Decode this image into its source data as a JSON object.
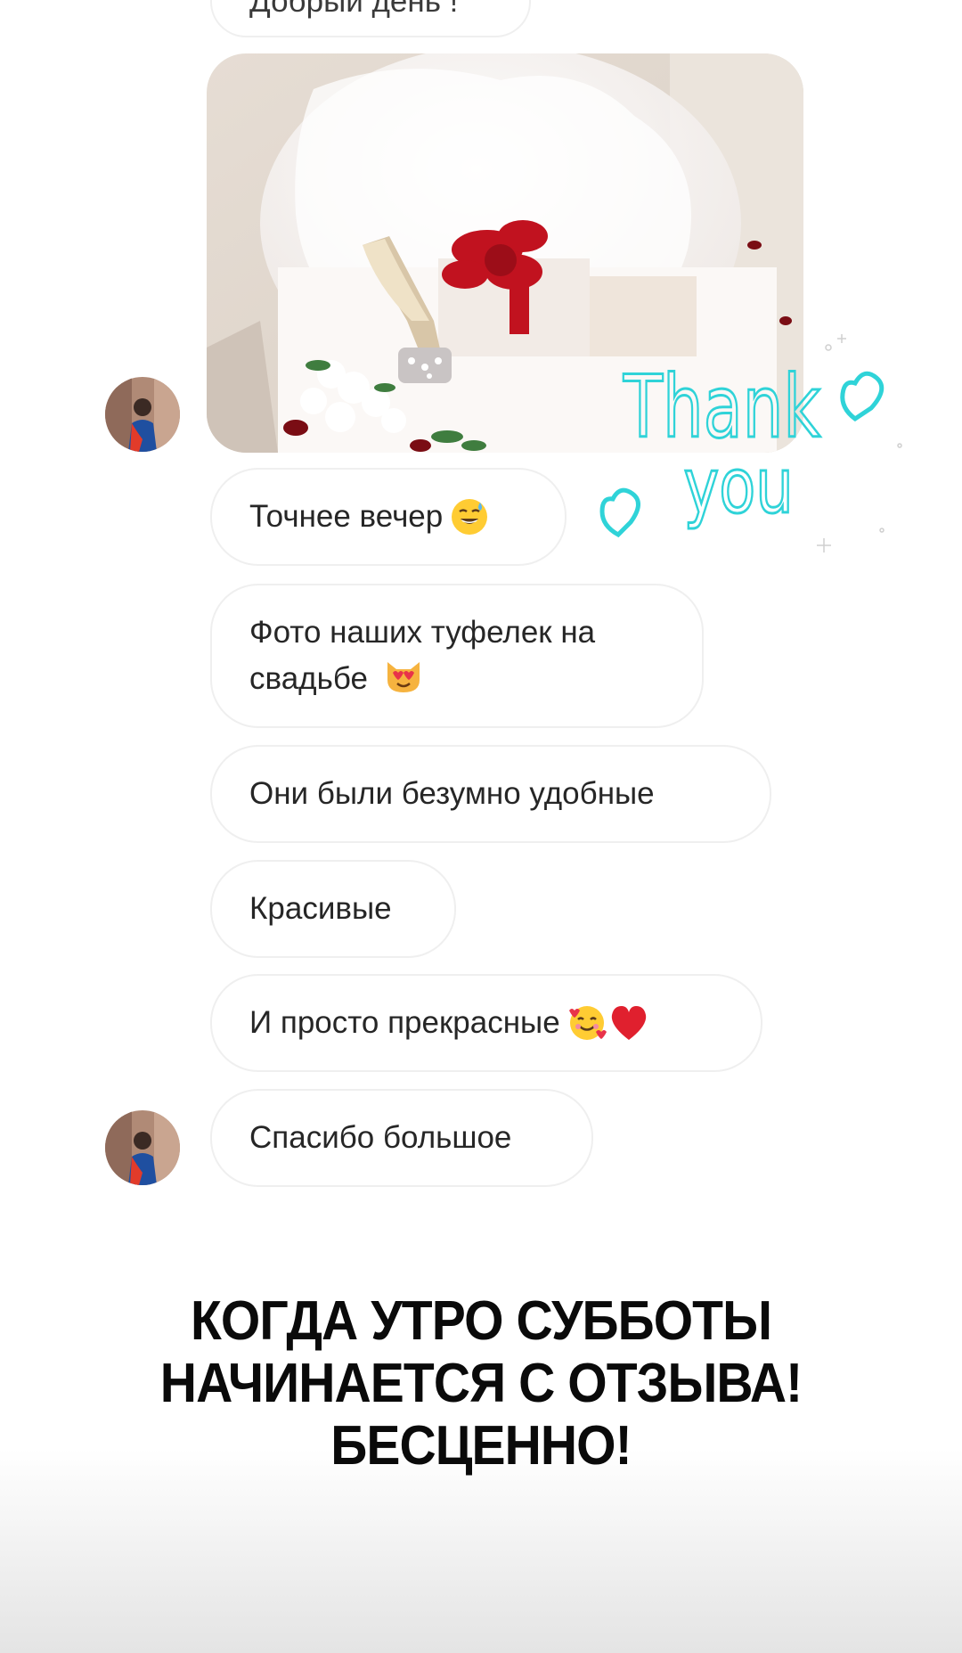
{
  "chat": {
    "partial_top_message": "Добрый день !",
    "messages": [
      {
        "text": "Точнее вечер",
        "emoji": "grinning-sweat-emoji"
      },
      {
        "text": "Фото наших туфелек на свадьбе",
        "emoji": "heart-eyes-cat-emoji"
      },
      {
        "text": "Они были безумно удобные"
      },
      {
        "text": "Красивые"
      },
      {
        "text": "И просто прекрасные",
        "emoji": "smiling-hearts-emoji red-heart-emoji"
      },
      {
        "text": "Спасибо большое"
      }
    ]
  },
  "sticker": {
    "line1": "Thank",
    "line2": "you",
    "color": "#2fd3d8"
  },
  "caption": {
    "line1": "КОГДА УТРО СУББОТЫ",
    "line2": "НАЧИНАЕТСЯ С ОТЗЫВА!",
    "line3": "БЕСЦЕННО!"
  }
}
